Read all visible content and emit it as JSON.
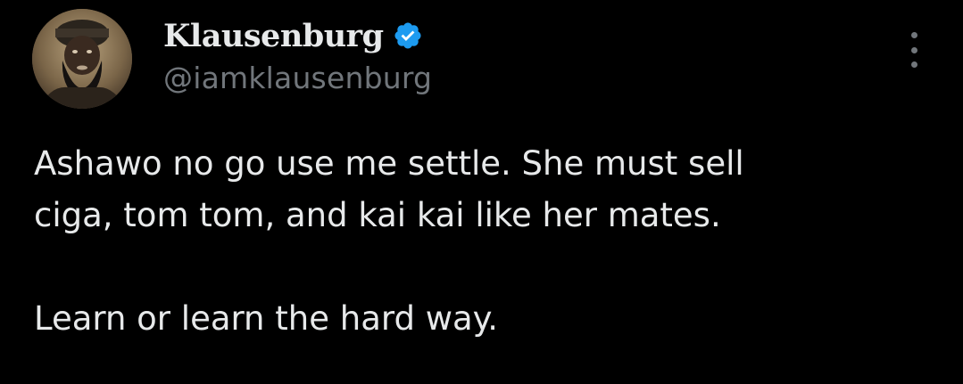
{
  "tweet": {
    "author": {
      "display_name": "Klausenburg",
      "handle": "@iamklausenburg",
      "verified": true,
      "verified_color": "#1d9bf0"
    },
    "more_icon": "more-vertical-icon",
    "text_lines": [
      "Ashawo no go use me settle. She must sell",
      "ciga, tom tom, and kai kai like her mates.",
      "Learn or learn the hard way."
    ]
  },
  "colors": {
    "background": "#000000",
    "text": "#e7e9ea",
    "secondary_text": "#71767b"
  }
}
